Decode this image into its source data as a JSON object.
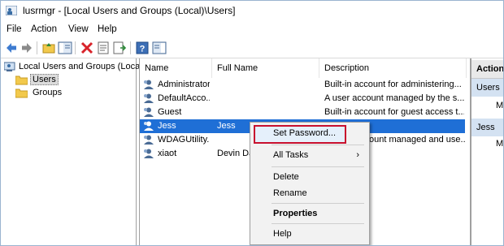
{
  "window": {
    "title": "lusrmgr - [Local Users and Groups (Local)\\Users]"
  },
  "menubar": {
    "items": [
      "File",
      "Action",
      "View",
      "Help"
    ]
  },
  "toolbar": {
    "buttons": [
      "back-arrow-icon",
      "forward-arrow-icon",
      "up-folder-icon",
      "show-hide-tree-icon",
      "delete-icon",
      "properties-icon",
      "export-list-icon",
      "help-icon",
      "show-action-pane-icon"
    ]
  },
  "tree": {
    "root": "Local Users and Groups (Local)",
    "items": [
      {
        "label": "Users",
        "selected": true
      },
      {
        "label": "Groups",
        "selected": false
      }
    ]
  },
  "list": {
    "columns": [
      "Name",
      "Full Name",
      "Description"
    ],
    "rows": [
      {
        "name": "Administrator",
        "full_name": "",
        "description": "Built-in account for administering..."
      },
      {
        "name": "DefaultAcco...",
        "full_name": "",
        "description": "A user account managed by the s..."
      },
      {
        "name": "Guest",
        "full_name": "",
        "description": "Built-in account for guest access t..."
      },
      {
        "name": "Jess",
        "full_name": "Jess",
        "description": "",
        "selected": true
      },
      {
        "name": "WDAGUtility...",
        "full_name": "",
        "description": "ount managed and use..."
      },
      {
        "name": "xiaot",
        "full_name": "Devin Da",
        "description": ""
      }
    ]
  },
  "actions": {
    "header": "Actions",
    "sections": [
      {
        "title": "Users",
        "item": "M"
      },
      {
        "title": "Jess",
        "item": "M"
      }
    ]
  },
  "context_menu": {
    "set_password": "Set Password...",
    "all_tasks": "All Tasks",
    "submenu_arrow": "›",
    "delete": "Delete",
    "rename": "Rename",
    "properties": "Properties",
    "help": "Help"
  },
  "colors": {
    "selection": "#1f6fd6",
    "highlight_border": "#c8102e"
  }
}
